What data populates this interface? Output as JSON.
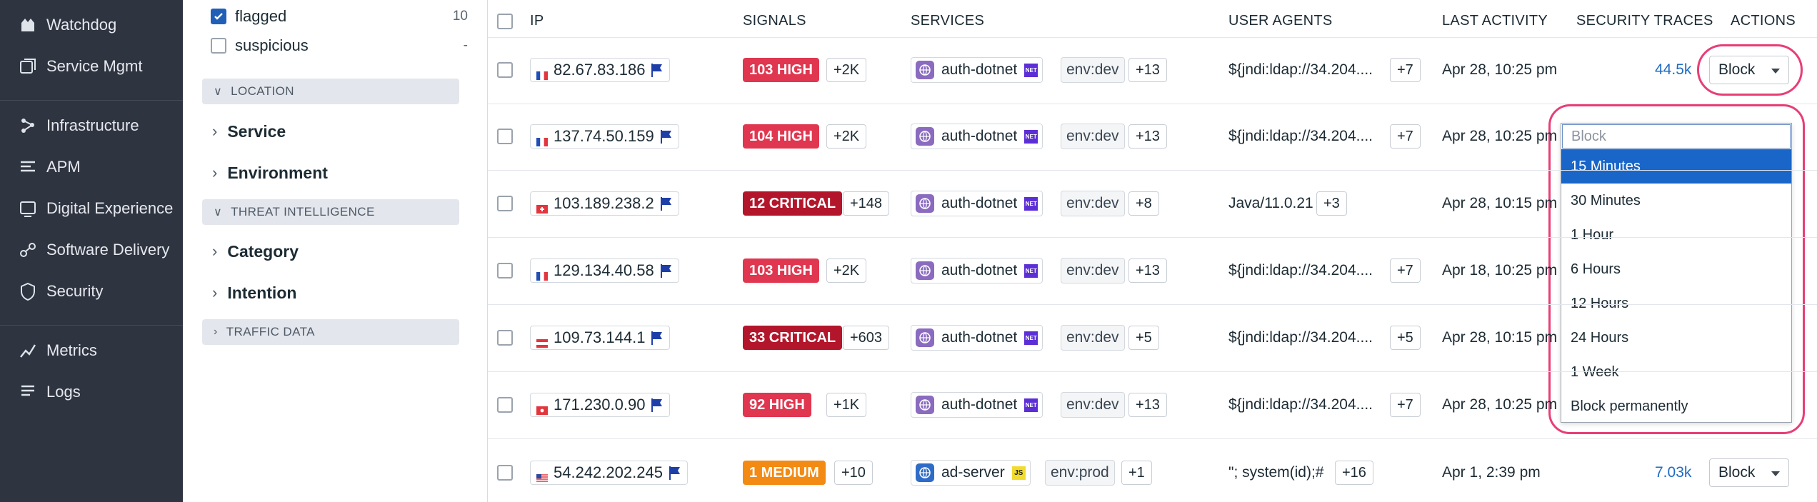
{
  "nav": {
    "items": [
      {
        "label": "Watchdog",
        "icon": "watchdog-icon"
      },
      {
        "label": "Service Mgmt",
        "icon": "service-mgmt-icon"
      },
      {
        "label": "Infrastructure",
        "icon": "infrastructure-icon"
      },
      {
        "label": "APM",
        "icon": "apm-icon"
      },
      {
        "label": "Digital Experience",
        "icon": "digital-experience-icon"
      },
      {
        "label": "Software Delivery",
        "icon": "software-delivery-icon"
      },
      {
        "label": "Security",
        "icon": "security-icon"
      },
      {
        "label": "Metrics",
        "icon": "metrics-icon"
      },
      {
        "label": "Logs",
        "icon": "logs-icon"
      }
    ]
  },
  "facets": {
    "checks": [
      {
        "label": "flagged",
        "count": "10",
        "checked": true
      },
      {
        "label": "suspicious",
        "count": "-",
        "checked": false
      }
    ],
    "location_section": "LOCATION",
    "location_items": [
      "Service",
      "Environment"
    ],
    "threat_section": "THREAT INTELLIGENCE",
    "threat_items": [
      "Category",
      "Intention"
    ],
    "traffic_section": "TRAFFIC DATA"
  },
  "table": {
    "headers": {
      "ip": "IP",
      "signals": "SIGNALS",
      "services": "SERVICES",
      "user_agents": "USER AGENTS",
      "last_activity": "LAST ACTIVITY",
      "security_traces": "SECURITY TRACES",
      "actions": "ACTIONS"
    },
    "rows": [
      {
        "ip": "82.67.83.186",
        "country": "fr",
        "signal": "103 HIGH",
        "signal_level": "high",
        "signal_more": "+2K",
        "service": "auth-dotnet",
        "lang": "NET",
        "env": "env:dev",
        "svc_more": "+13",
        "ua": "${jndi:ldap://34.204....",
        "ua_more": "+7",
        "last": "Apr 28, 10:25 pm",
        "traces": "44.5k",
        "action": "Block"
      },
      {
        "ip": "137.74.50.159",
        "country": "fr",
        "signal": "104 HIGH",
        "signal_level": "high",
        "signal_more": "+2K",
        "service": "auth-dotnet",
        "lang": "NET",
        "env": "env:dev",
        "svc_more": "+13",
        "ua": "${jndi:ldap://34.204....",
        "ua_more": "+7",
        "last": "Apr 28, 10:25 pm",
        "traces": "",
        "action": ""
      },
      {
        "ip": "103.189.238.2",
        "country": "ch",
        "signal": "12 CRITICAL",
        "signal_level": "critical",
        "signal_more": "+148",
        "service": "auth-dotnet",
        "lang": "NET",
        "env": "env:dev",
        "svc_more": "+8",
        "ua": "Java/11.0.21",
        "ua_more": "+3",
        "last": "Apr 28, 10:15 pm",
        "traces": "",
        "action": ""
      },
      {
        "ip": "129.134.40.58",
        "country": "fr",
        "signal": "103 HIGH",
        "signal_level": "high",
        "signal_more": "+2K",
        "service": "auth-dotnet",
        "lang": "NET",
        "env": "env:dev",
        "svc_more": "+13",
        "ua": "${jndi:ldap://34.204....",
        "ua_more": "+7",
        "last": "Apr 18, 10:25 pm",
        "traces": "",
        "action": ""
      },
      {
        "ip": "109.73.144.1",
        "country": "at",
        "signal": "33 CRITICAL",
        "signal_level": "critical",
        "signal_more": "+603",
        "service": "auth-dotnet",
        "lang": "NET",
        "env": "env:dev",
        "svc_more": "+5",
        "ua": "${jndi:ldap://34.204....",
        "ua_more": "+5",
        "last": "Apr 28, 10:15 pm",
        "traces": "",
        "action": ""
      },
      {
        "ip": "171.230.0.90",
        "country": "hk",
        "signal": "92 HIGH",
        "signal_level": "high",
        "signal_more": "+1K",
        "service": "auth-dotnet",
        "lang": "NET",
        "env": "env:dev",
        "svc_more": "+13",
        "ua": "${jndi:ldap://34.204....",
        "ua_more": "+7",
        "last": "Apr 28, 10:25 pm",
        "traces": "",
        "action": ""
      },
      {
        "ip": "54.242.202.245",
        "country": "us",
        "signal": "1 MEDIUM",
        "signal_level": "medium",
        "signal_more": "+10",
        "service": "ad-server",
        "lang": "JS",
        "env": "env:prod",
        "svc_more": "+1",
        "ua": "\"; system(id);#",
        "ua_more": "+16",
        "last": "Apr 1, 2:39 pm",
        "traces": "7.03k",
        "action": "Block"
      }
    ]
  },
  "dropdown": {
    "placeholder": "Block",
    "options": [
      "15 Minutes",
      "30 Minutes",
      "1 Hour",
      "6 Hours",
      "12 Hours",
      "24 Hours",
      "1 Week",
      "Block permanently"
    ],
    "selected_index": 0
  },
  "colors": {
    "nav_bg": "#2e3440",
    "high": "#e0364f",
    "critical": "#b3162b",
    "medium": "#f28a14",
    "highlight_ring": "#e83e76",
    "link": "#1f6bc4",
    "option_selected": "#1966c8"
  }
}
